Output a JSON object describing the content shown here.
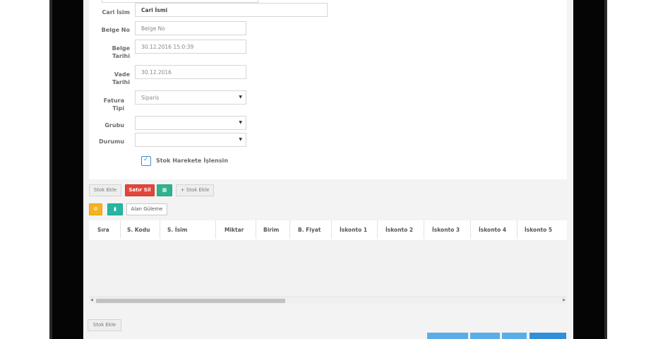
{
  "form": {
    "cari_isim_label": "Cari İsim",
    "cari_isim_value": "Cari İsmi",
    "belge_no_label": "Belge No",
    "belge_no_placeholder": "Belge No",
    "belge_tarihi_label_1": "Belge",
    "belge_tarihi_label_2": "Tarihi",
    "belge_tarihi_value": "30.12.2016 15:0:39",
    "vade_tarihi_label_1": "Vade",
    "vade_tarihi_label_2": "Tarihi",
    "vade_tarihi_value": "30.12.2016",
    "fatura_tipi_label_1": "Fatura",
    "fatura_tipi_label_2": "Tipi",
    "fatura_tipi_value": "Siparis",
    "grubu_label": "Grubu",
    "grubu_value": "",
    "durumu_label": "Durumu",
    "durumu_value": "",
    "stok_checkbox_label": "Stok Harekete İşlensin",
    "stok_checkbox_checked": true
  },
  "toolbar": {
    "stok_ekle": "Stok Ekle",
    "satir_sil": "Satır Sil",
    "add_stock": "+ Stok Ekle",
    "alan_guleme": "Alan Güleme"
  },
  "table": {
    "columns": [
      "Sıra",
      "S. Kodu",
      "S. İsim",
      "Miktar",
      "Birim",
      "B. Fiyat",
      "İskonto 1",
      "İskonto 2",
      "İskonto 3",
      "İskonto 4",
      "İskonto 5"
    ],
    "rows": []
  },
  "footer": {
    "stok_ekle": "Stok Ekle"
  },
  "colors": {
    "accent_red": "#e0463b",
    "accent_green": "#2fb28f",
    "accent_yellow": "#f5b120",
    "accent_blue": "#5aaee8",
    "checkbox_blue": "#3b8fd3"
  },
  "icons": [
    "settings-icon",
    "chart-icon",
    "grid-icon",
    "check-icon",
    "dropdown-arrow-icon",
    "scroll-left-icon",
    "scroll-right-icon"
  ]
}
